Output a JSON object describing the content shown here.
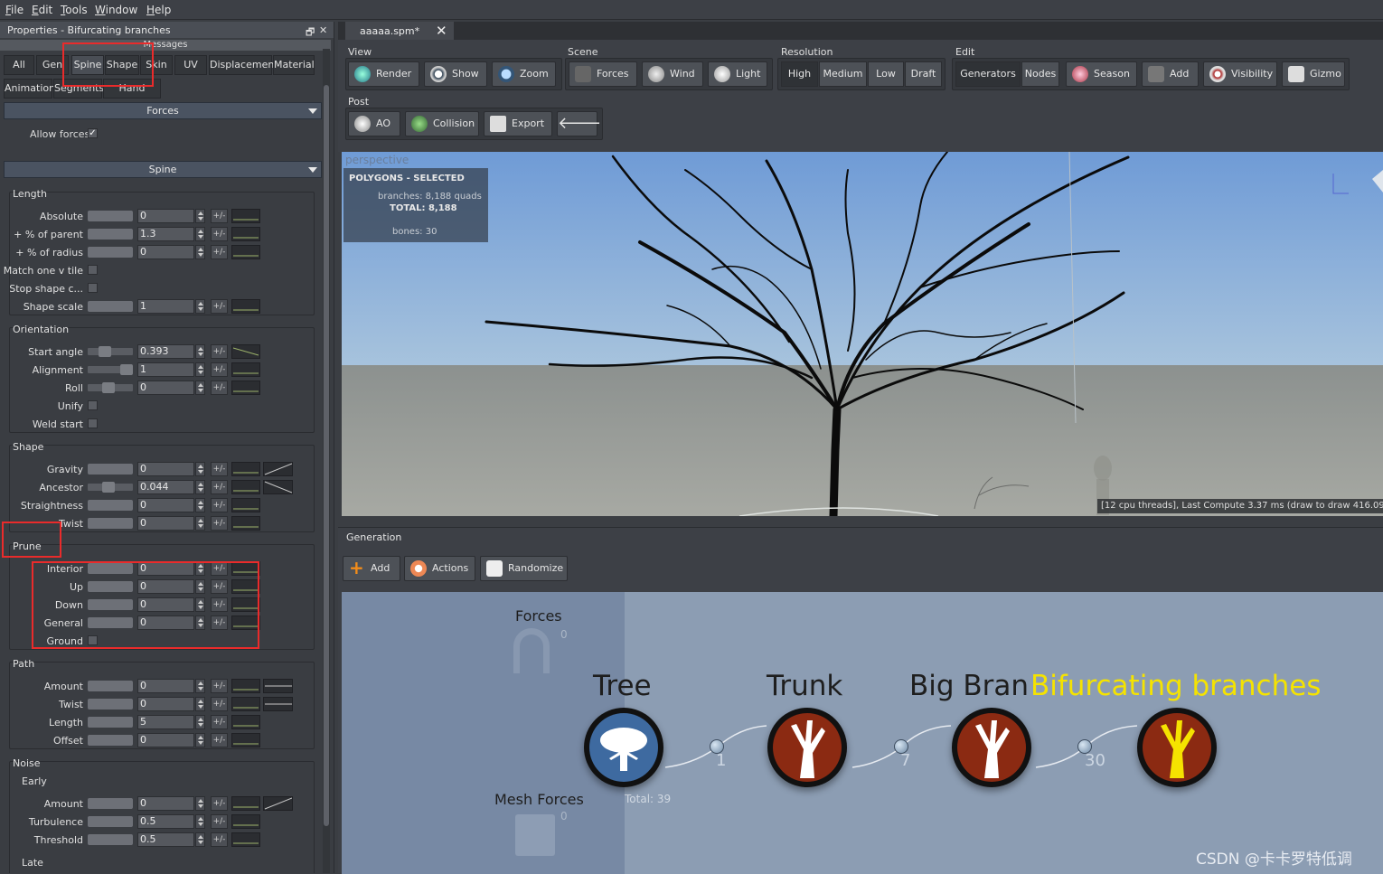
{
  "menu": [
    {
      "pre": "",
      "u": "F",
      "post": "ile"
    },
    {
      "pre": "",
      "u": "E",
      "post": "dit"
    },
    {
      "pre": "",
      "u": "T",
      "post": "ools"
    },
    {
      "pre": "",
      "u": "W",
      "post": "indow"
    },
    {
      "pre": "",
      "u": "H",
      "post": "elp"
    }
  ],
  "properties": {
    "title": "Properties - Bifurcating branches",
    "messages_label": "Messages",
    "tabs_row1": [
      "All",
      "Gen",
      "Spine",
      "Shape",
      "Skin",
      "UV",
      "Displacement",
      "Material"
    ],
    "tabs_row2": [
      "Animation",
      "Segments",
      "Hand Drawn"
    ],
    "forces_header": "Forces",
    "allow_forces": "Allow forces",
    "spine_header": "Spine",
    "groups": {
      "length": {
        "title": "Length",
        "rows": [
          {
            "label": "Absolute",
            "value": "0"
          },
          {
            "label": "+ % of parent",
            "value": "1.3"
          },
          {
            "label": "+ % of radius",
            "value": "0"
          },
          {
            "label": "Match one v tile",
            "value": null
          },
          {
            "label": "Stop shape c...",
            "value": null
          },
          {
            "label": "Shape scale",
            "value": "1"
          }
        ]
      },
      "orientation": {
        "title": "Orientation",
        "rows": [
          {
            "label": "Start angle",
            "value": "0.393"
          },
          {
            "label": "Alignment",
            "value": "1"
          },
          {
            "label": "Roll",
            "value": "0"
          },
          {
            "label": "Unify",
            "value": null
          },
          {
            "label": "Weld start",
            "value": null
          }
        ]
      },
      "shape": {
        "title": "Shape",
        "rows": [
          {
            "label": "Gravity",
            "value": "0"
          },
          {
            "label": "Ancestor",
            "value": "0.044"
          },
          {
            "label": "Straightness",
            "value": "0"
          },
          {
            "label": "Twist",
            "value": "0"
          }
        ]
      },
      "prune": {
        "title": "Prune",
        "rows": [
          {
            "label": "Interior",
            "value": "0"
          },
          {
            "label": "Up",
            "value": "0"
          },
          {
            "label": "Down",
            "value": "0"
          },
          {
            "label": "General",
            "value": "0"
          },
          {
            "label": "Ground",
            "value": null
          }
        ]
      },
      "path": {
        "title": "Path",
        "rows": [
          {
            "label": "Amount",
            "value": "0"
          },
          {
            "label": "Twist",
            "value": "0"
          },
          {
            "label": "Length",
            "value": "5"
          },
          {
            "label": "Offset",
            "value": "0"
          }
        ]
      },
      "noise": {
        "title": "Noise",
        "sub_early": "Early",
        "rows": [
          {
            "label": "Amount",
            "value": "0"
          },
          {
            "label": "Turbulence",
            "value": "0.5"
          },
          {
            "label": "Threshold",
            "value": "0.5"
          }
        ],
        "sub_late": "Late"
      }
    },
    "pm": "+/-"
  },
  "doc_tab": "aaaaa.spm*",
  "toolbar": {
    "view_label": "View",
    "view": [
      "Render",
      "Show",
      "Zoom"
    ],
    "scene_label": "Scene",
    "scene": [
      "Forces",
      "Wind",
      "Light"
    ],
    "resolution_label": "Resolution",
    "resolution": [
      "High",
      "Medium",
      "Low",
      "Draft"
    ],
    "edit_label": "Edit",
    "edit_toggle": [
      "Generators",
      "Nodes"
    ],
    "edit": [
      "Season",
      "Add",
      "Visibility",
      "Gizmo"
    ],
    "post_label": "Post",
    "post": [
      "AO",
      "Collision",
      "Export"
    ]
  },
  "viewport": {
    "title": "perspective",
    "stats_title": "POLYGONS - SELECTED",
    "branches": "branches:  8,188 quads",
    "total": "TOTAL:  8,188",
    "bones": "bones:  30",
    "status": "[12 cpu threads], Last Compute 3.37 ms (draw to draw 416.09"
  },
  "generation": {
    "title": "Generation",
    "buttons": [
      "Add",
      "Actions",
      "Randomize"
    ],
    "forces_label": "Forces",
    "forces_count": "0",
    "mesh_forces_label": "Mesh Forces",
    "mesh_forces_count": "0",
    "nodes": [
      "Tree",
      "Trunk",
      "Big Bran",
      "Bifurcating branches"
    ],
    "conn_counts": [
      "1",
      "7",
      "30"
    ],
    "total": "Total: 39"
  },
  "watermark": "CSDN @卡卡罗特低调",
  "colors": {
    "selected_node_label": "#f5e300",
    "node_red": "#8b2a12",
    "node_blue": "#3e6aa0"
  }
}
